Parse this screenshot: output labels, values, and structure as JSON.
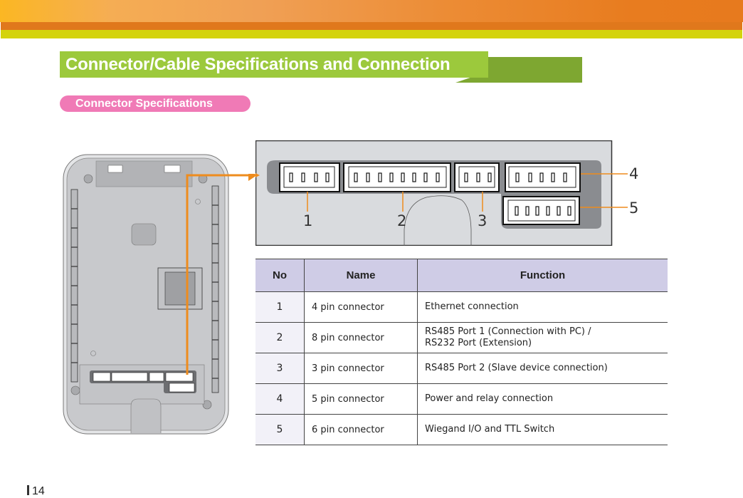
{
  "header": {
    "colors": {
      "gradient_start": "#fbb723",
      "gradient_end": "#e77a1e",
      "orange_band": "#e0781c",
      "lime_band": "#d4d30c"
    }
  },
  "title": {
    "text": "Connector/Cable Specifications and Connection",
    "color": "#9cc93c"
  },
  "section": {
    "label": "Connector Specifications",
    "color": "#f07ab6"
  },
  "diagram": {
    "callouts": [
      "1",
      "2",
      "3",
      "4",
      "5"
    ],
    "connectors": [
      {
        "no": "1",
        "pins": 4
      },
      {
        "no": "2",
        "pins": 8
      },
      {
        "no": "3",
        "pins": 3
      },
      {
        "no": "4",
        "pins": 5
      },
      {
        "no": "5",
        "pins": 6
      }
    ],
    "arrow_color": "#ee8c1e"
  },
  "table": {
    "headers": [
      "No",
      "Name",
      "Function"
    ],
    "rows": [
      {
        "no": "1",
        "name": "4 pin connector",
        "function": "Ethernet connection",
        "function2": ""
      },
      {
        "no": "2",
        "name": "8 pin connector",
        "function": "RS485 Port 1 (Connection with PC) /",
        "function2": "RS232 Port  (Extension)"
      },
      {
        "no": "3",
        "name": "3 pin connector",
        "function": "RS485 Port 2 (Slave device connection)",
        "function2": ""
      },
      {
        "no": "4",
        "name": "5 pin connector",
        "function": "Power and relay connection",
        "function2": ""
      },
      {
        "no": "5",
        "name": "6 pin connector",
        "function": "Wiegand I/O and TTL Switch",
        "function2": ""
      }
    ]
  },
  "footer": {
    "page_number": "14"
  }
}
